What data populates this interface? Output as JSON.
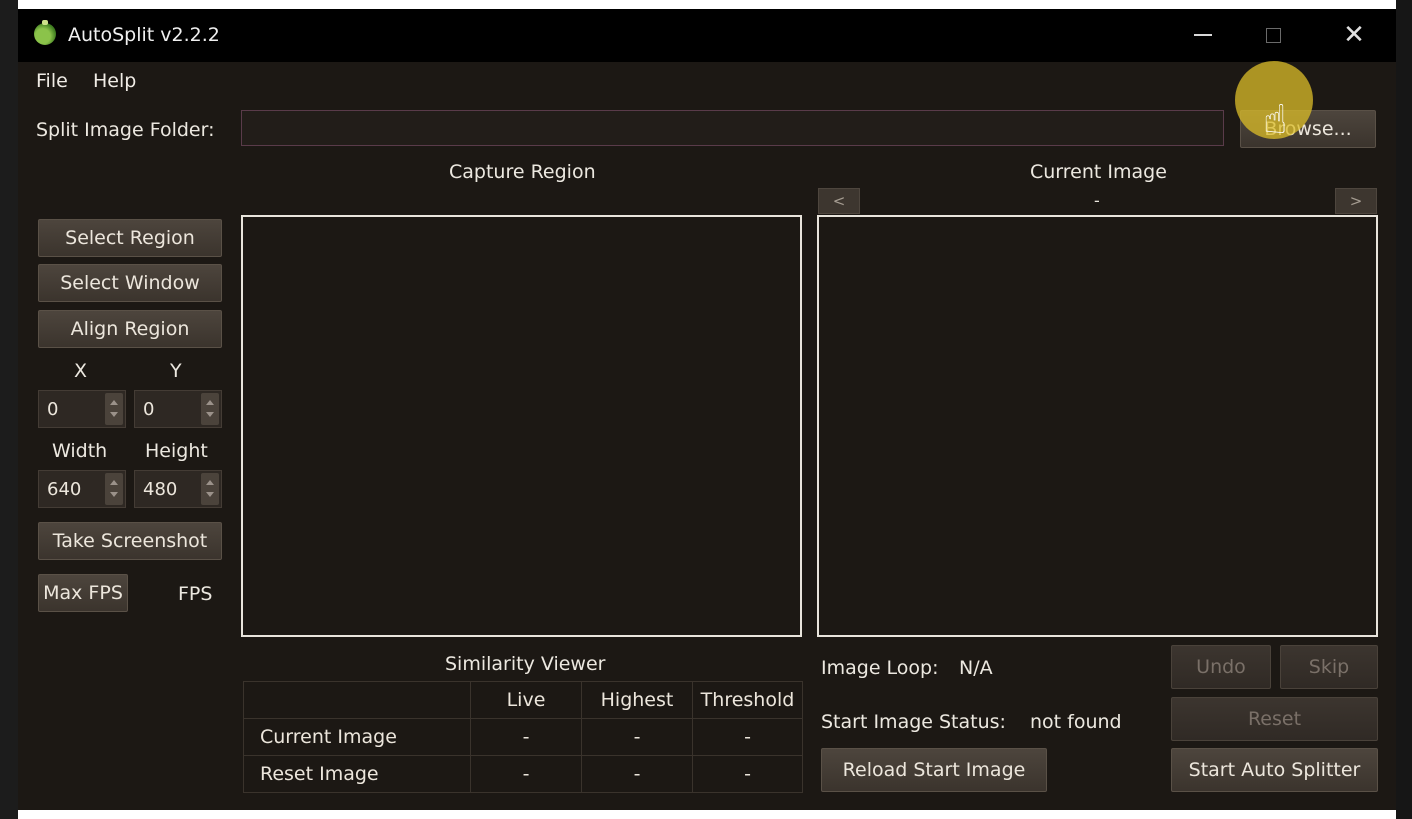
{
  "window": {
    "title": "AutoSplit v2.2.2"
  },
  "menu": {
    "items": [
      "File",
      "Help"
    ]
  },
  "folder": {
    "label": "Split Image Folder:",
    "value": "",
    "browse_label": "Browse..."
  },
  "capture": {
    "title": "Capture Region",
    "select_region_label": "Select Region",
    "select_window_label": "Select Window",
    "align_region_label": "Align Region",
    "x_label": "X",
    "y_label": "Y",
    "x_value": "0",
    "y_value": "0",
    "width_label": "Width",
    "height_label": "Height",
    "width_value": "640",
    "height_value": "480",
    "screenshot_label": "Take Screenshot",
    "max_fps_label": "Max FPS",
    "fps_label": "FPS"
  },
  "current_image": {
    "title": "Current Image",
    "prev_label": "<",
    "next_label": ">",
    "name": "-"
  },
  "similarity": {
    "title": "Similarity Viewer",
    "columns": [
      "Live",
      "Highest",
      "Threshold"
    ],
    "rows": [
      {
        "label": "Current Image",
        "values": [
          "-",
          "-",
          "-"
        ]
      },
      {
        "label": "Reset Image",
        "values": [
          "-",
          "-",
          "-"
        ]
      }
    ]
  },
  "status": {
    "loop_label": "Image Loop:",
    "loop_value": "N/A",
    "start_status_label": "Start Image Status:",
    "start_status_value": "not found"
  },
  "controls": {
    "undo_label": "Undo",
    "skip_label": "Skip",
    "reset_label": "Reset",
    "reload_label": "Reload Start Image",
    "start_label": "Start Auto Splitter"
  }
}
